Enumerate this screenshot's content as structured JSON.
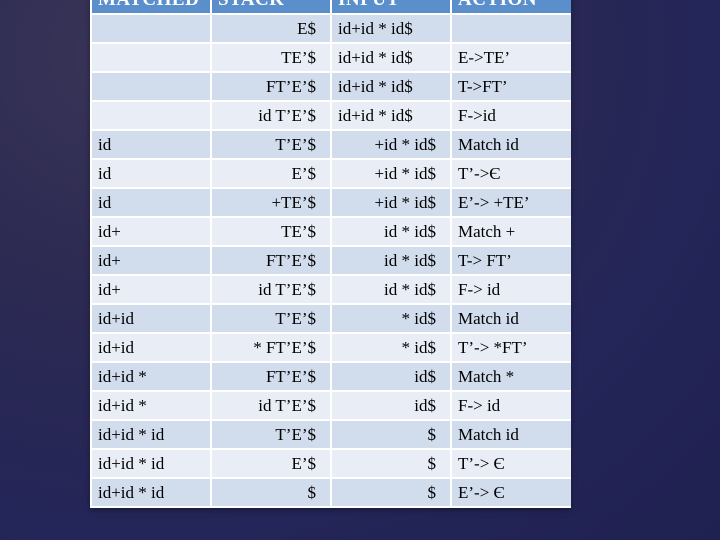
{
  "table": {
    "headers": [
      "MATCHED",
      "STACK",
      "INPUT",
      "ACTION"
    ],
    "rows": [
      {
        "matched": "",
        "stack": "E$",
        "input": "id+id * id$",
        "action": ""
      },
      {
        "matched": "",
        "stack": "TE’$",
        "input": "id+id * id$",
        "action": "E->TE’"
      },
      {
        "matched": "",
        "stack": "FT’E’$",
        "input": "id+id * id$",
        "action": "T->FT’"
      },
      {
        "matched": "",
        "stack": "id T’E’$",
        "input": "id+id * id$",
        "action": "F->id"
      },
      {
        "matched": "id",
        "stack": "T’E’$",
        "input": "+id * id$",
        "action": "Match id"
      },
      {
        "matched": "id",
        "stack": "E’$",
        "input": "+id * id$",
        "action": "T’->Є"
      },
      {
        "matched": "id",
        "stack": "+TE’$",
        "input": "+id * id$",
        "action": "E’-> +TE’"
      },
      {
        "matched": "id+",
        "stack": "TE’$",
        "input": "id * id$",
        "action": "Match +"
      },
      {
        "matched": "id+",
        "stack": "FT’E’$",
        "input": "id * id$",
        "action": "T-> FT’"
      },
      {
        "matched": "id+",
        "stack": "id T’E’$",
        "input": "id * id$",
        "action": "F-> id"
      },
      {
        "matched": "id+id",
        "stack": "T’E’$",
        "input": "* id$",
        "action": "Match id"
      },
      {
        "matched": "id+id",
        "stack": "* FT’E’$",
        "input": "* id$",
        "action": "T’-> *FT’"
      },
      {
        "matched": "id+id *",
        "stack": "FT’E’$",
        "input": "id$",
        "action": "Match *"
      },
      {
        "matched": "id+id *",
        "stack": "id T’E’$",
        "input": "id$",
        "action": "F-> id"
      },
      {
        "matched": "id+id * id",
        "stack": "T’E’$",
        "input": "$",
        "action": "Match id"
      },
      {
        "matched": "id+id * id",
        "stack": "E’$",
        "input": "$",
        "action": "T’-> Є"
      },
      {
        "matched": "id+id * id",
        "stack": "$",
        "input": "$",
        "action": "E’-> Є"
      }
    ]
  },
  "colors": {
    "header_bg": "#5b8fcb",
    "row_odd_bg": "#d1dcec",
    "row_even_bg": "#e9eef6",
    "page_bg": "#262656"
  }
}
